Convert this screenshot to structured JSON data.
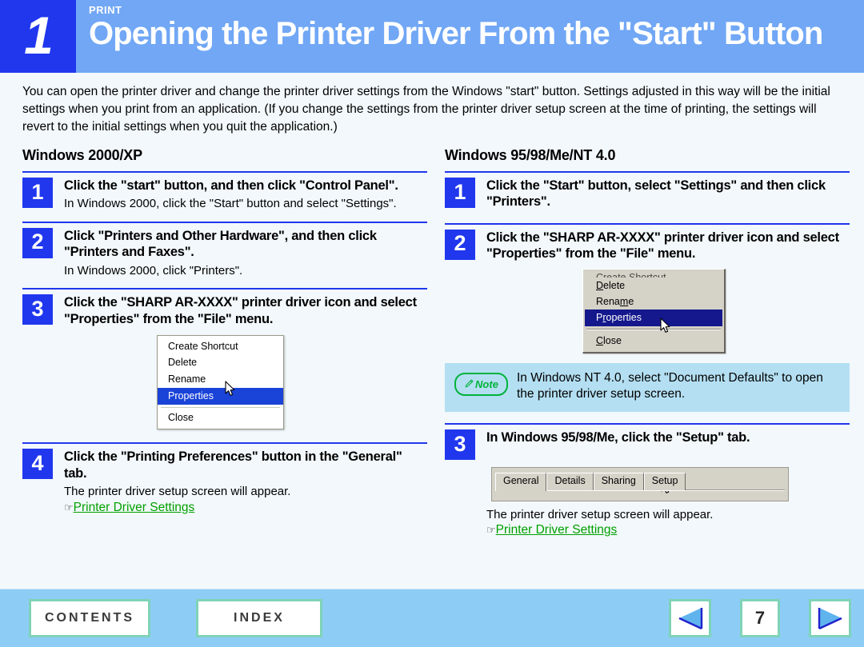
{
  "header": {
    "chapter_number": "1",
    "kicker": "PRINT",
    "title": "Opening the Printer Driver From the \"Start\" Button",
    "colors": {
      "number_block": "#2037ee",
      "band": "#71a7f5",
      "text": "#ffffff"
    }
  },
  "intro": "You can open the printer driver and change the printer driver settings from the Windows \"start\" button. Settings adjusted in this way will be the initial settings when you print from an application. (If you change the settings from the printer driver setup screen at the time of printing, the settings will revert to the initial settings when you quit the application.)",
  "left_column": {
    "heading": "Windows 2000/XP",
    "steps": [
      {
        "num": "1",
        "title": "Click the \"start\" button, and then click \"Control Panel\".",
        "sub": "In Windows 2000, click the \"Start\" button and select \"Settings\"."
      },
      {
        "num": "2",
        "title": "Click \"Printers and Other Hardware\", and then click \"Printers and Faxes\".",
        "sub": "In Windows 2000, click \"Printers\"."
      },
      {
        "num": "3",
        "title": "Click the \"SHARP AR-XXXX\" printer driver icon and select \"Properties\" from the \"File\" menu.",
        "sub": ""
      },
      {
        "num": "4",
        "title": "Click the \"Printing Preferences\" button in the \"General\" tab.",
        "sub": "The printer driver setup screen will appear.",
        "link": "Printer Driver Settings"
      }
    ],
    "menu": {
      "items": [
        "Create Shortcut",
        "Delete",
        "Rename",
        "Properties",
        "Close"
      ],
      "selected": "Properties",
      "highlight_color": "#1a43d8"
    }
  },
  "right_column": {
    "heading": "Windows 95/98/Me/NT 4.0",
    "steps": [
      {
        "num": "1",
        "title": "Click the \"Start\" button, select \"Settings\" and then click \"Printers\"."
      },
      {
        "num": "2",
        "title": "Click the \"SHARP AR-XXXX\" printer driver icon and select \"Properties\" from the \"File\" menu."
      },
      {
        "num": "3",
        "title": "In Windows 95/98/Me, click the \"Setup\" tab.",
        "sub": "The printer driver setup screen will appear.",
        "link": "Printer Driver Settings"
      }
    ],
    "menu": {
      "items": [
        "Create Shortcut",
        "Delete",
        "Rename",
        "Properties",
        "Close"
      ],
      "selected": "Properties",
      "highlight_color": "#14188c"
    },
    "note": {
      "badge": "Note",
      "text": "In Windows NT 4.0, select \"Document Defaults\" to open the printer driver setup screen.",
      "bg_color": "#b4dff2",
      "badge_color": "#00b33c"
    },
    "tabs": {
      "items": [
        "General",
        "Details",
        "Sharing",
        "Setup"
      ],
      "active": "General"
    }
  },
  "footer": {
    "contents_label": "CONTENTS",
    "index_label": "INDEX",
    "page_number": "7",
    "prev_icon": "triangle-left-icon",
    "next_icon": "triangle-right-icon",
    "bg_color": "#8dcdf5",
    "button_border": "#7fd3b8"
  },
  "link_color": "#00a000",
  "hand_glyph": "☞"
}
